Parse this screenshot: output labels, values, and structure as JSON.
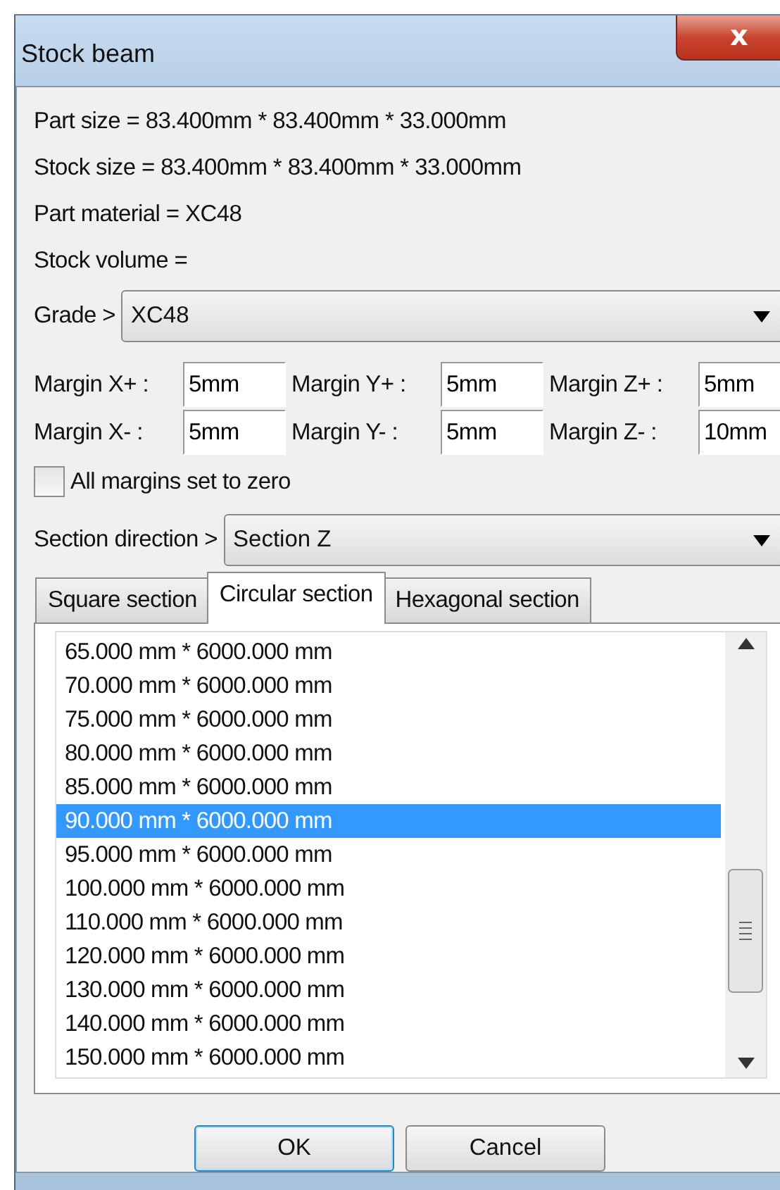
{
  "window": {
    "title": "Stock beam",
    "close_label": "x"
  },
  "info": [
    "Part size = 83.400mm * 83.400mm * 33.000mm",
    "Stock size = 83.400mm * 83.400mm * 33.000mm",
    "Part material = XC48",
    "Stock volume ="
  ],
  "grade": {
    "label": "Grade >",
    "value": "XC48"
  },
  "margins": [
    {
      "label": "Margin X+ :",
      "value": "5mm"
    },
    {
      "label": "Margin Y+ :",
      "value": "5mm"
    },
    {
      "label": "Margin Z+ :",
      "value": "5mm"
    },
    {
      "label": "Margin X-  :",
      "value": "5mm"
    },
    {
      "label": "Margin Y-  :",
      "value": "5mm"
    },
    {
      "label": "Margin Z-  :",
      "value": "10mm"
    }
  ],
  "zero_checkbox": {
    "label": "All margins set to zero",
    "checked": false
  },
  "section_direction": {
    "label": "Section direction >",
    "value": "Section Z"
  },
  "tabs": [
    {
      "label": "Square section",
      "selected": false
    },
    {
      "label": "Circular section",
      "selected": true
    },
    {
      "label": "Hexagonal section",
      "selected": false
    }
  ],
  "list": [
    {
      "text": "65.000 mm * 6000.000 mm",
      "selected": false
    },
    {
      "text": "70.000 mm * 6000.000 mm",
      "selected": false
    },
    {
      "text": "75.000 mm * 6000.000 mm",
      "selected": false
    },
    {
      "text": "80.000 mm * 6000.000 mm",
      "selected": false
    },
    {
      "text": "85.000 mm * 6000.000 mm",
      "selected": false
    },
    {
      "text": "90.000 mm * 6000.000 mm",
      "selected": true
    },
    {
      "text": "95.000 mm * 6000.000 mm",
      "selected": false
    },
    {
      "text": "100.000 mm * 6000.000 mm",
      "selected": false
    },
    {
      "text": "110.000 mm * 6000.000 mm",
      "selected": false
    },
    {
      "text": "120.000 mm * 6000.000 mm",
      "selected": false
    },
    {
      "text": "130.000 mm * 6000.000 mm",
      "selected": false
    },
    {
      "text": "140.000 mm * 6000.000 mm",
      "selected": false
    },
    {
      "text": "150.000 mm * 6000.000 mm",
      "selected": false
    }
  ],
  "buttons": [
    "OK",
    "Cancel"
  ]
}
